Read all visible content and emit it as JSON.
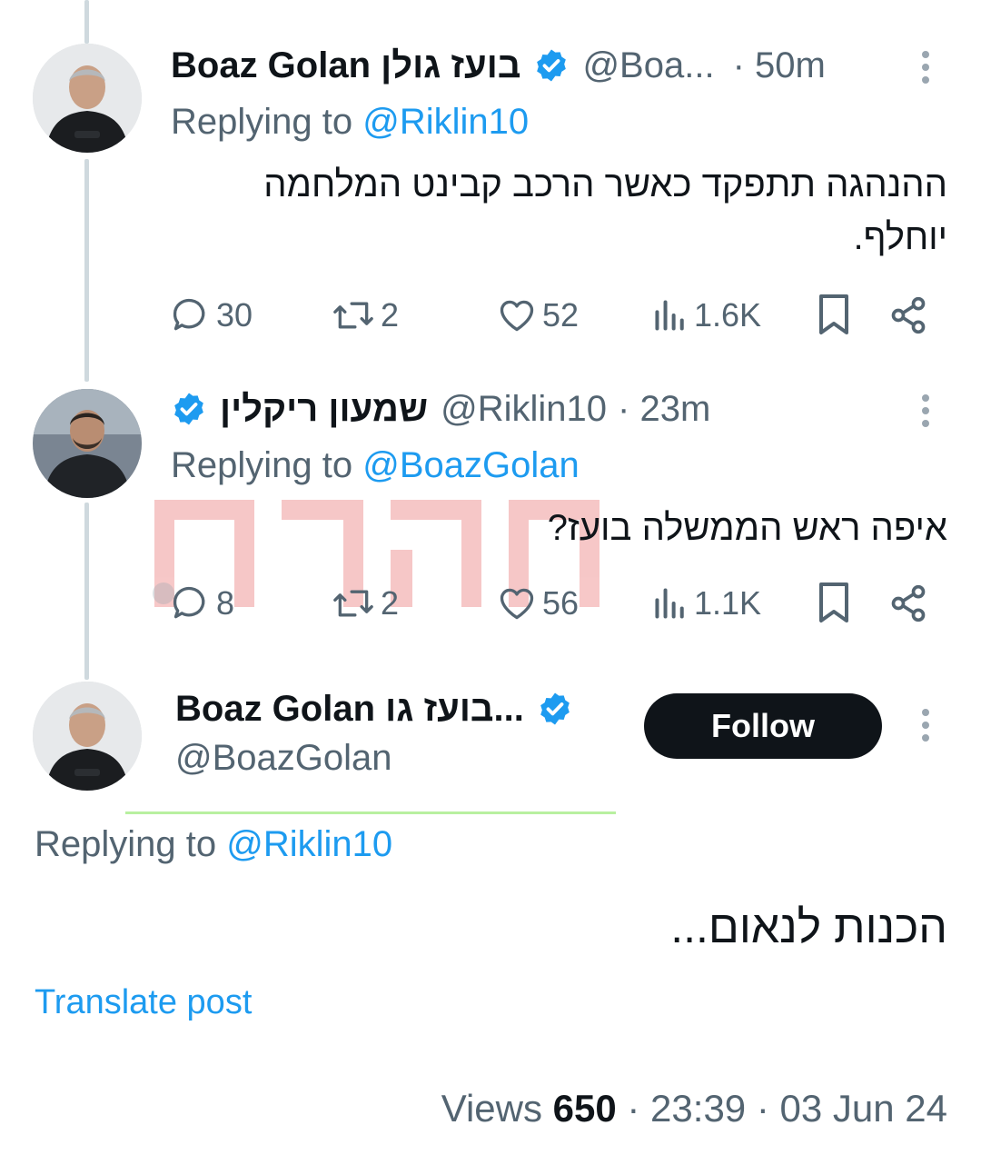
{
  "posts": [
    {
      "name": "Boaz Golan בועז גולן",
      "handle": "@Boa...",
      "time": "· 50m",
      "replying_prefix": "Replying to",
      "replying_to": "@Riklin10",
      "text_line1": "ההנהגה תתפקד כאשר הרכב קבינט המלחמה",
      "text_line2": "יוחלף.",
      "replies": "30",
      "reposts": "2",
      "likes": "52",
      "views": "1.6K"
    },
    {
      "name": "שמעון ריקלין",
      "handle": "@Riklin10",
      "time": "· 23m",
      "replying_prefix": "Replying to",
      "replying_to": "@BoazGolan",
      "text_line1": "איפה ראש הממשלה בועז?",
      "replies": "8",
      "reposts": "2",
      "likes": "56",
      "views": "1.1K"
    }
  ],
  "main_post": {
    "name": "Boaz Golan בועז גו...",
    "handle": "@BoazGolan",
    "follow_label": "Follow",
    "replying_prefix": "Replying to",
    "replying_to": "@Riklin10",
    "text": "הכנות לנאום...",
    "translate": "Translate post",
    "views_label": "Views",
    "views_count": "650",
    "time": "· 23:39 ·",
    "date": "03 Jun 24"
  },
  "colors": {
    "accent": "#1d9bf0",
    "secondary_text": "#536471",
    "primary_text": "#0f1419",
    "watermark": "#e23b3b"
  },
  "icons": [
    "verified-badge-icon",
    "reply-icon",
    "repost-icon",
    "like-icon",
    "views-icon",
    "bookmark-icon",
    "share-icon",
    "more-icon"
  ]
}
